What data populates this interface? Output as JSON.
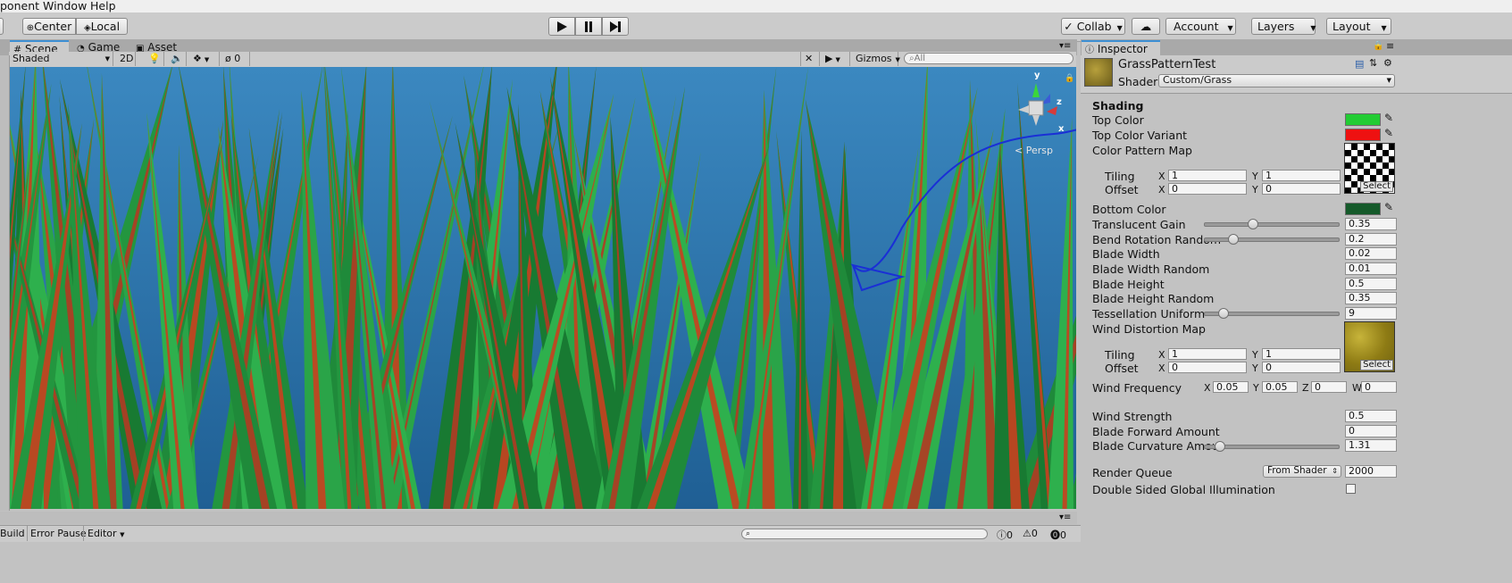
{
  "menu": {
    "items": [
      "ponent",
      "Window",
      "Help"
    ]
  },
  "toolbar": {
    "pivot_label": "Center",
    "space_label": "Local",
    "play_icon": "play-icon",
    "pause_icon": "pause-icon",
    "step_icon": "step-icon",
    "collab_label": "Collab",
    "account_label": "Account",
    "layers_label": "Layers",
    "layout_label": "Layout"
  },
  "scene_tabs": [
    {
      "label": "Scene",
      "icon": "hash-icon"
    },
    {
      "label": "Game",
      "icon": "pacman-icon"
    },
    {
      "label": "Asset Store",
      "icon": "bag-icon"
    }
  ],
  "scene_bar": {
    "shading_mode": "Shaded",
    "mode_2d": "2D",
    "hidden_count": "0",
    "gizmos_label": "Gizmos",
    "search_placeholder": "All"
  },
  "gizmo": {
    "y": "y",
    "z": "z",
    "x": "x",
    "persp": "< Persp"
  },
  "inspector": {
    "tab_label": "Inspector",
    "material_name": "GrassPatternTest",
    "shader_label": "Shader",
    "shader_value": "Custom/Grass",
    "section_shading": "Shading",
    "top_color": {
      "label": "Top Color",
      "value": "#22cc33"
    },
    "top_color_variant": {
      "label": "Top Color Variant",
      "value": "#ee1111"
    },
    "color_pattern_map": {
      "label": "Color Pattern Map",
      "select": "Select"
    },
    "tiling1": {
      "label": "Tiling",
      "x_label": "X",
      "x": "1",
      "y_label": "Y",
      "y": "1"
    },
    "offset1": {
      "label": "Offset",
      "x_label": "X",
      "x": "0",
      "y_label": "Y",
      "y": "0"
    },
    "bottom_color": {
      "label": "Bottom Color",
      "value": "#155a2a"
    },
    "translucent_gain": {
      "label": "Translucent Gain",
      "value": "0.35",
      "fraction": 0.35
    },
    "bend_rotation_random": {
      "label": "Bend Rotation Random",
      "value": "0.2",
      "fraction": 0.2
    },
    "blade_width": {
      "label": "Blade Width",
      "value": "0.02"
    },
    "blade_width_random": {
      "label": "Blade Width Random",
      "value": "0.01"
    },
    "blade_height": {
      "label": "Blade Height",
      "value": "0.5"
    },
    "blade_height_random": {
      "label": "Blade Height Random",
      "value": "0.35"
    },
    "tessellation_uniform": {
      "label": "Tessellation Uniform",
      "value": "9",
      "fraction": 0.14
    },
    "wind_distortion_map": {
      "label": "Wind Distortion Map",
      "select": "Select"
    },
    "tiling2": {
      "label": "Tiling",
      "x_label": "X",
      "x": "1",
      "y_label": "Y",
      "y": "1"
    },
    "offset2": {
      "label": "Offset",
      "x_label": "X",
      "x": "0",
      "y_label": "Y",
      "y": "0"
    },
    "wind_frequency": {
      "label": "Wind Frequency",
      "x_label": "X",
      "x": "0.05",
      "y_label": "Y",
      "y": "0.05",
      "z_label": "Z",
      "z": "0",
      "w_label": "W",
      "w": "0"
    },
    "wind_strength": {
      "label": "Wind Strength",
      "value": "0.5"
    },
    "blade_forward_amount": {
      "label": "Blade Forward Amount",
      "value": "0"
    },
    "blade_curvature_amount": {
      "label": "Blade Curvature Amour",
      "value": "1.31",
      "fraction": 0.1
    },
    "render_queue": {
      "label": "Render Queue",
      "mode": "From Shader",
      "value": "2000"
    },
    "double_sided_gi": {
      "label": "Double Sided Global Illumination",
      "checked": false
    }
  },
  "bottom": {
    "build_label": "Build",
    "error_pause_label": "Error Pause",
    "editor_label": "Editor",
    "info_count": "0",
    "warn_count": "0",
    "error_count": "0"
  }
}
